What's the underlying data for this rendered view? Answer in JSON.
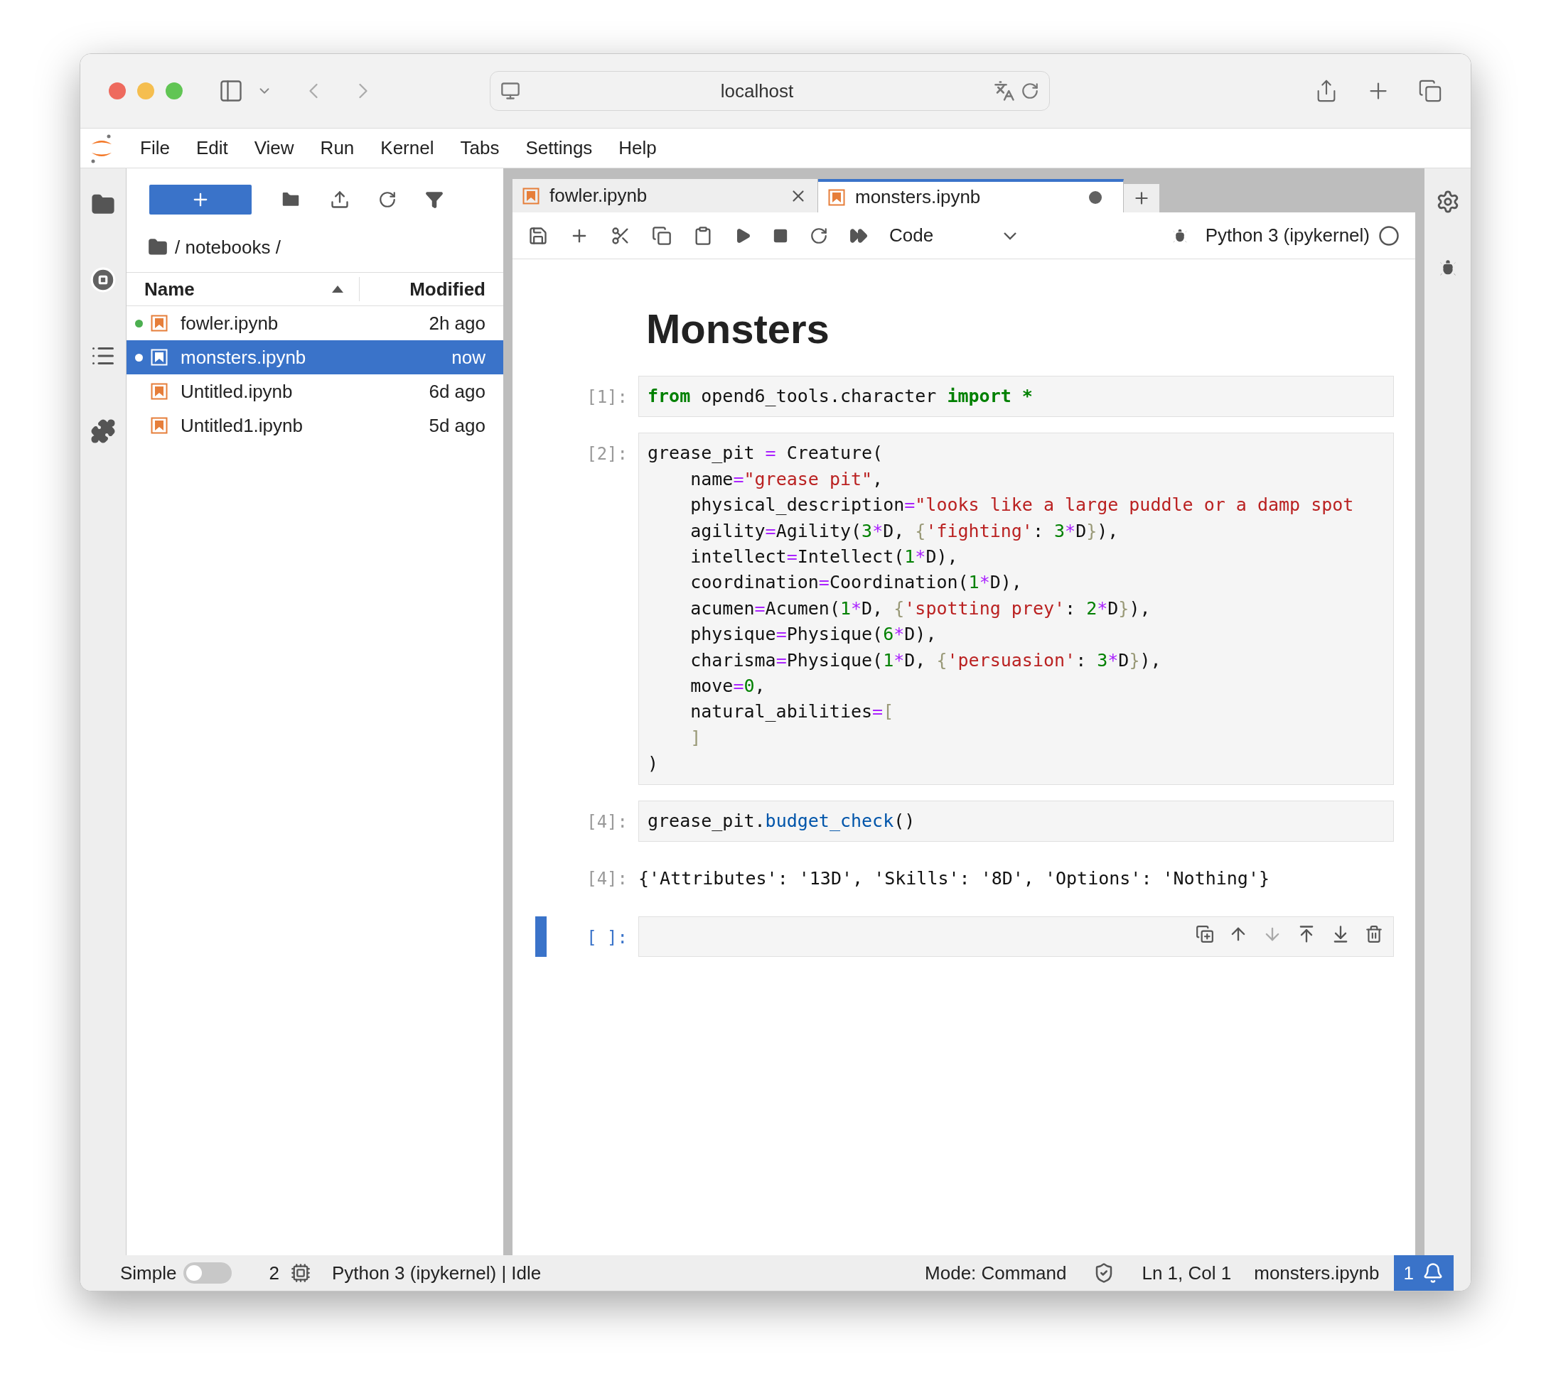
{
  "browser": {
    "address": "localhost"
  },
  "menu": [
    "File",
    "Edit",
    "View",
    "Run",
    "Kernel",
    "Tabs",
    "Settings",
    "Help"
  ],
  "file_browser": {
    "path": "/ notebooks /",
    "columns": [
      "Name",
      "Modified"
    ],
    "files": [
      {
        "name": "fowler.ipynb",
        "modified": "2h ago",
        "selected": false,
        "running": true
      },
      {
        "name": "monsters.ipynb",
        "modified": "now",
        "selected": true,
        "running": true
      },
      {
        "name": "Untitled.ipynb",
        "modified": "6d ago",
        "selected": false,
        "running": false
      },
      {
        "name": "Untitled1.ipynb",
        "modified": "5d ago",
        "selected": false,
        "running": false
      }
    ]
  },
  "tabs": [
    {
      "label": "fowler.ipynb",
      "selected": false,
      "dirty": false
    },
    {
      "label": "monsters.ipynb",
      "selected": true,
      "dirty": true
    }
  ],
  "toolbar": {
    "cell_type": "Code",
    "kernel": "Python 3 (ipykernel)"
  },
  "notebook": {
    "heading": "Monsters",
    "cells": [
      {
        "kind": "code",
        "prompt": "[1]:",
        "active": false,
        "lines": [
          [
            {
              "kind": "keyword",
              "text": "from"
            },
            {
              "kind": "plain",
              "text": " opend6_tools.character "
            },
            {
              "kind": "keyword",
              "text": "import"
            },
            {
              "kind": "keyword",
              "text": " *"
            }
          ]
        ]
      },
      {
        "kind": "code",
        "prompt": "[2]:",
        "active": false,
        "lines": [
          [
            {
              "kind": "plain",
              "text": "grease_pit "
            },
            {
              "kind": "op",
              "text": "="
            },
            {
              "kind": "plain",
              "text": " Creature("
            }
          ],
          [
            {
              "kind": "plain",
              "text": "    name"
            },
            {
              "kind": "op",
              "text": "="
            },
            {
              "kind": "string",
              "text": "\"grease pit\""
            },
            {
              "kind": "plain",
              "text": ","
            }
          ],
          [
            {
              "kind": "plain",
              "text": "    physical_description"
            },
            {
              "kind": "op",
              "text": "="
            },
            {
              "kind": "string",
              "text": "\"looks like a large puddle or a damp spot"
            }
          ],
          [
            {
              "kind": "plain",
              "text": "    agility"
            },
            {
              "kind": "op",
              "text": "="
            },
            {
              "kind": "plain",
              "text": "Agility("
            },
            {
              "kind": "number",
              "text": "3"
            },
            {
              "kind": "op",
              "text": "*"
            },
            {
              "kind": "plain",
              "text": "D, "
            },
            {
              "kind": "bracket",
              "text": "{"
            },
            {
              "kind": "string",
              "text": "'fighting'"
            },
            {
              "kind": "plain",
              "text": ": "
            },
            {
              "kind": "number",
              "text": "3"
            },
            {
              "kind": "op",
              "text": "*"
            },
            {
              "kind": "plain",
              "text": "D"
            },
            {
              "kind": "bracket",
              "text": "}"
            },
            {
              "kind": "plain",
              "text": "),"
            }
          ],
          [
            {
              "kind": "plain",
              "text": "    intellect"
            },
            {
              "kind": "op",
              "text": "="
            },
            {
              "kind": "plain",
              "text": "Intellect("
            },
            {
              "kind": "number",
              "text": "1"
            },
            {
              "kind": "op",
              "text": "*"
            },
            {
              "kind": "plain",
              "text": "D),"
            }
          ],
          [
            {
              "kind": "plain",
              "text": "    coordination"
            },
            {
              "kind": "op",
              "text": "="
            },
            {
              "kind": "plain",
              "text": "Coordination("
            },
            {
              "kind": "number",
              "text": "1"
            },
            {
              "kind": "op",
              "text": "*"
            },
            {
              "kind": "plain",
              "text": "D),"
            }
          ],
          [
            {
              "kind": "plain",
              "text": "    acumen"
            },
            {
              "kind": "op",
              "text": "="
            },
            {
              "kind": "plain",
              "text": "Acumen("
            },
            {
              "kind": "number",
              "text": "1"
            },
            {
              "kind": "op",
              "text": "*"
            },
            {
              "kind": "plain",
              "text": "D, "
            },
            {
              "kind": "bracket",
              "text": "{"
            },
            {
              "kind": "string",
              "text": "'spotting prey'"
            },
            {
              "kind": "plain",
              "text": ": "
            },
            {
              "kind": "number",
              "text": "2"
            },
            {
              "kind": "op",
              "text": "*"
            },
            {
              "kind": "plain",
              "text": "D"
            },
            {
              "kind": "bracket",
              "text": "}"
            },
            {
              "kind": "plain",
              "text": "),"
            }
          ],
          [
            {
              "kind": "plain",
              "text": "    physique"
            },
            {
              "kind": "op",
              "text": "="
            },
            {
              "kind": "plain",
              "text": "Physique("
            },
            {
              "kind": "number",
              "text": "6"
            },
            {
              "kind": "op",
              "text": "*"
            },
            {
              "kind": "plain",
              "text": "D),"
            }
          ],
          [
            {
              "kind": "plain",
              "text": "    charisma"
            },
            {
              "kind": "op",
              "text": "="
            },
            {
              "kind": "plain",
              "text": "Physique("
            },
            {
              "kind": "number",
              "text": "1"
            },
            {
              "kind": "op",
              "text": "*"
            },
            {
              "kind": "plain",
              "text": "D, "
            },
            {
              "kind": "bracket",
              "text": "{"
            },
            {
              "kind": "string",
              "text": "'persuasion'"
            },
            {
              "kind": "plain",
              "text": ": "
            },
            {
              "kind": "number",
              "text": "3"
            },
            {
              "kind": "op",
              "text": "*"
            },
            {
              "kind": "plain",
              "text": "D"
            },
            {
              "kind": "bracket",
              "text": "}"
            },
            {
              "kind": "plain",
              "text": "),"
            }
          ],
          [
            {
              "kind": "plain",
              "text": "    move"
            },
            {
              "kind": "op",
              "text": "="
            },
            {
              "kind": "number",
              "text": "0"
            },
            {
              "kind": "plain",
              "text": ","
            }
          ],
          [
            {
              "kind": "plain",
              "text": "    natural_abilities"
            },
            {
              "kind": "op",
              "text": "="
            },
            {
              "kind": "bracket",
              "text": "["
            }
          ],
          [
            {
              "kind": "bracket",
              "text": "    ]"
            }
          ],
          [
            {
              "kind": "plain",
              "text": ")"
            }
          ]
        ]
      },
      {
        "kind": "code",
        "prompt": "[4]:",
        "active": false,
        "lines": [
          [
            {
              "kind": "plain",
              "text": "grease_pit."
            },
            {
              "kind": "func",
              "text": "budget_check"
            },
            {
              "kind": "plain",
              "text": "()"
            }
          ]
        ]
      },
      {
        "kind": "output",
        "prompt": "[4]:",
        "lines": [
          [
            {
              "kind": "plain",
              "text": "{'Attributes': '13D', 'Skills': '8D', 'Options': 'Nothing'}"
            }
          ]
        ]
      },
      {
        "kind": "code",
        "prompt": "[ ]:",
        "active": true
      }
    ]
  },
  "status_bar": {
    "mode_label": "Simple",
    "simple_on": false,
    "kernel_count": "2",
    "kernel_status": "Python 3 (ipykernel) | Idle",
    "mode": "Mode: Command",
    "position": "Ln 1, Col 1",
    "file": "monsters.ipynb",
    "notifications": "1"
  }
}
